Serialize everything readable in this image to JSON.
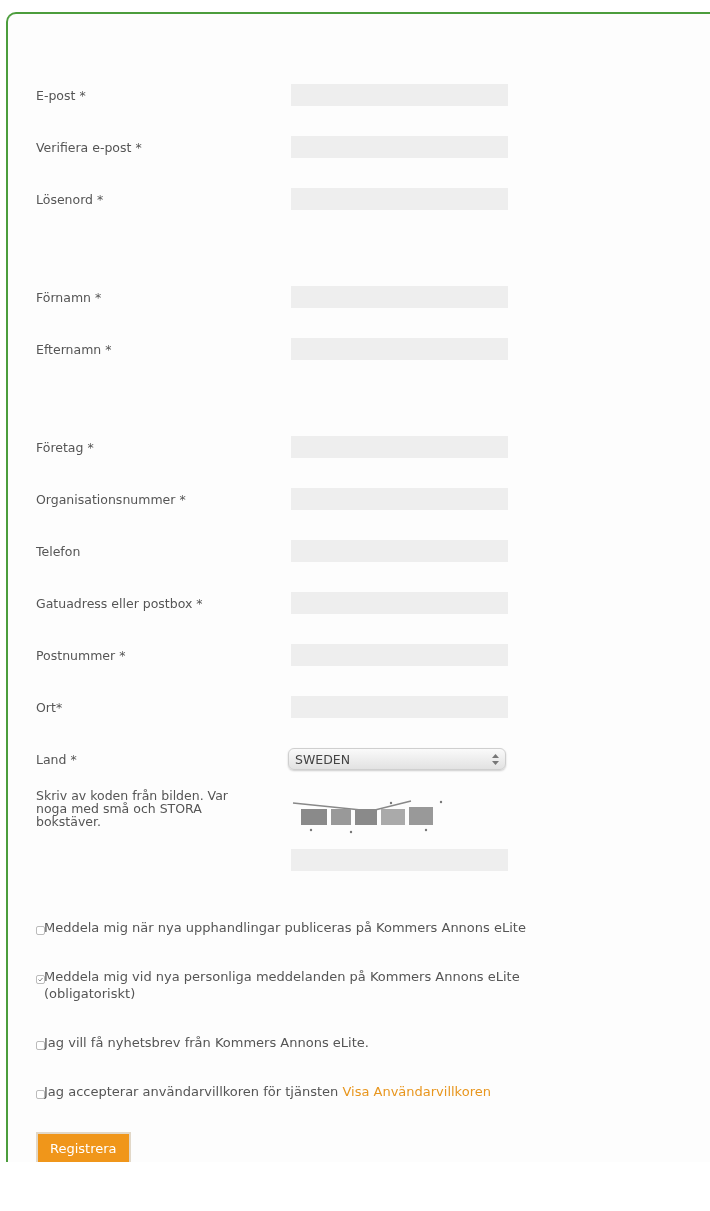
{
  "sections": [
    {
      "fields": [
        {
          "kind": "text",
          "label": "E-post *"
        },
        {
          "kind": "text",
          "label": "Verifiera e-post *"
        },
        {
          "kind": "password",
          "label": "Lösenord *"
        }
      ]
    },
    {
      "fields": [
        {
          "kind": "text",
          "label": "Förnamn *"
        },
        {
          "kind": "text",
          "label": "Efternamn *"
        }
      ]
    },
    {
      "fields": [
        {
          "kind": "text",
          "label": "Företag *"
        },
        {
          "kind": "text",
          "label": "Organisationsnummer *"
        },
        {
          "kind": "text",
          "label": "Telefon"
        },
        {
          "kind": "text",
          "label": "Gatuadress eller postbox *"
        },
        {
          "kind": "text",
          "label": "Postnummer *"
        },
        {
          "kind": "text",
          "label": "Ort*"
        },
        {
          "kind": "select",
          "label": "Land *",
          "value": "SWEDEN"
        },
        {
          "kind": "captcha",
          "label": "Skriv av koden från bilden. Var noga med små och STORA bokstäver."
        }
      ]
    }
  ],
  "checkboxes": [
    {
      "label": "Meddela mig när nya upphandlingar publiceras på Kommers Annons eLite",
      "checked": false
    },
    {
      "label": "Meddela mig vid nya personliga meddelanden på Kommers Annons eLite (obligatoriskt)",
      "checked": true
    },
    {
      "label": "Jag vill få nyhetsbrev från Kommers Annons eLite.",
      "checked": false
    },
    {
      "label": "Jag accepterar användarvillkoren för tjänsten",
      "checked": false,
      "link": "Visa Användarvillkoren"
    }
  ],
  "submit": "Registrera"
}
